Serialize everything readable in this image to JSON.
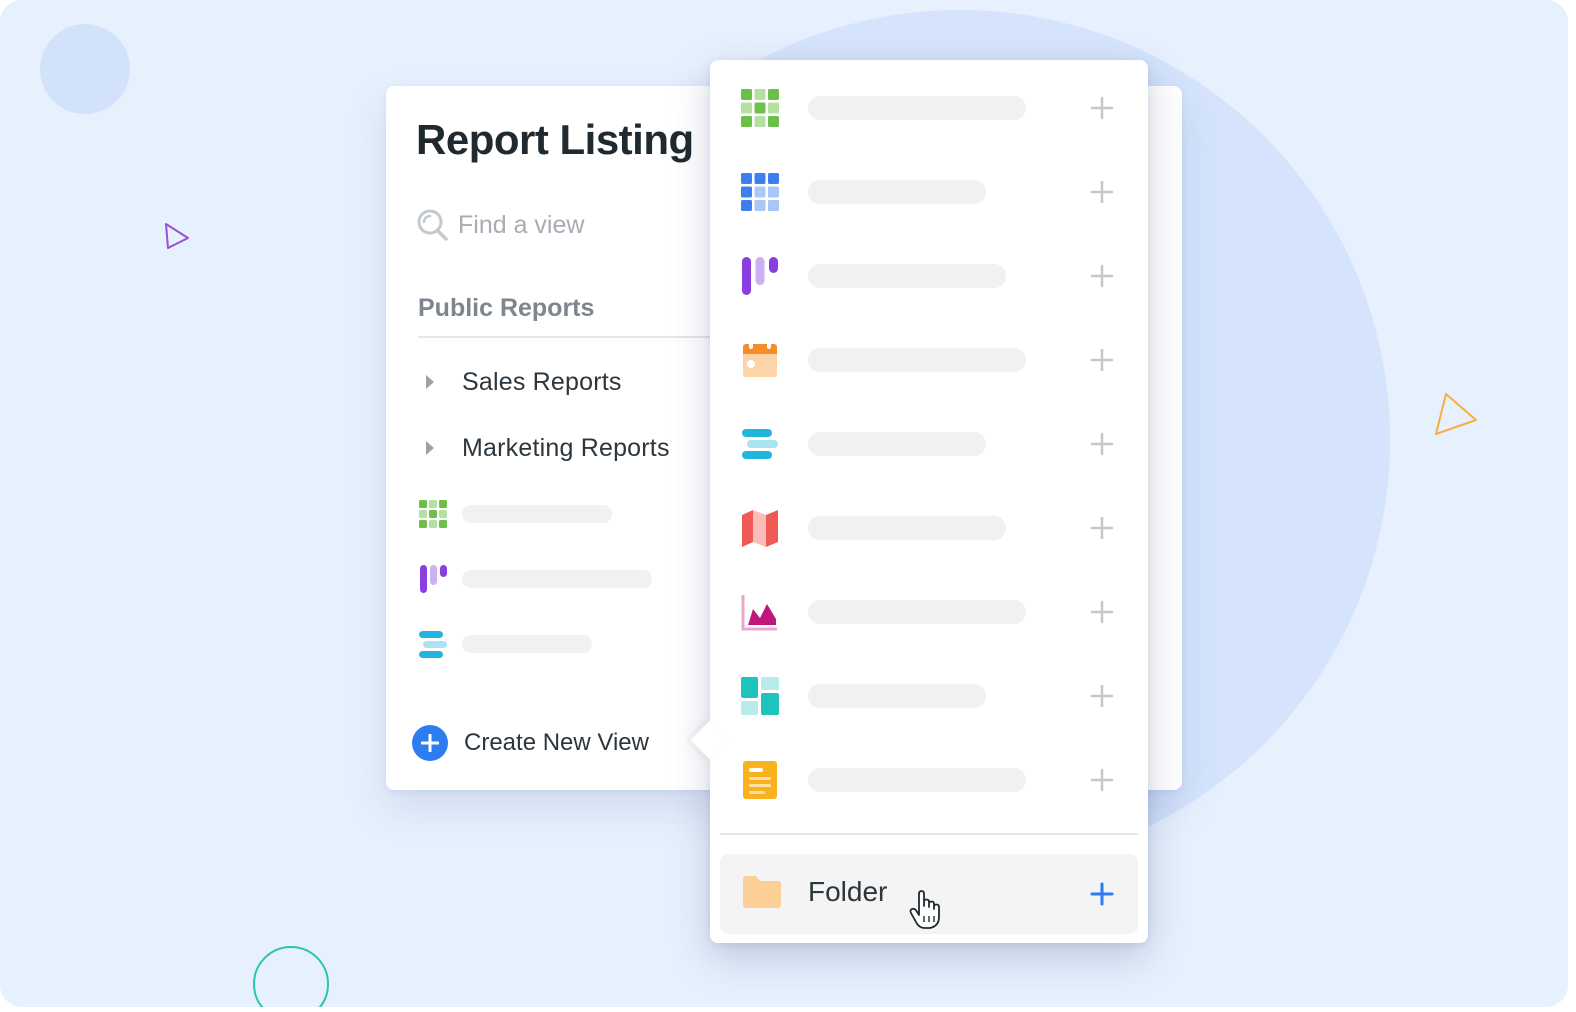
{
  "app": {
    "title": "Report Listing",
    "search": {
      "placeholder": "Find a view"
    },
    "section": {
      "label": "Public Reports"
    },
    "folders": [
      {
        "label": "Sales Reports"
      },
      {
        "label": "Marketing Reports"
      }
    ],
    "views": [
      {
        "icon": "grid-view-icon"
      },
      {
        "icon": "kanban-view-icon"
      },
      {
        "icon": "gantt-view-icon"
      }
    ],
    "create": {
      "label": "Create New View"
    }
  },
  "menu": {
    "items": [
      {
        "icon": "grid-view-icon",
        "color": "#6cc04a"
      },
      {
        "icon": "table-view-icon",
        "color": "#3d7ff0"
      },
      {
        "icon": "kanban-view-icon",
        "color": "#8a3ee0"
      },
      {
        "icon": "calendar-view-icon",
        "color": "#f7a04a"
      },
      {
        "icon": "gantt-view-icon",
        "color": "#22b6dd"
      },
      {
        "icon": "map-view-icon",
        "color": "#f05a55"
      },
      {
        "icon": "chart-view-icon",
        "color": "#c0187a"
      },
      {
        "icon": "dashboard-view-icon",
        "color": "#1ec4bb"
      },
      {
        "icon": "form-view-icon",
        "color": "#f9b21e"
      }
    ],
    "folder": {
      "label": "Folder",
      "icon": "folder-icon",
      "color": "#fbcf95"
    }
  },
  "colors": {
    "accent": "#2d7cf0",
    "background": "#e7f0fd"
  }
}
